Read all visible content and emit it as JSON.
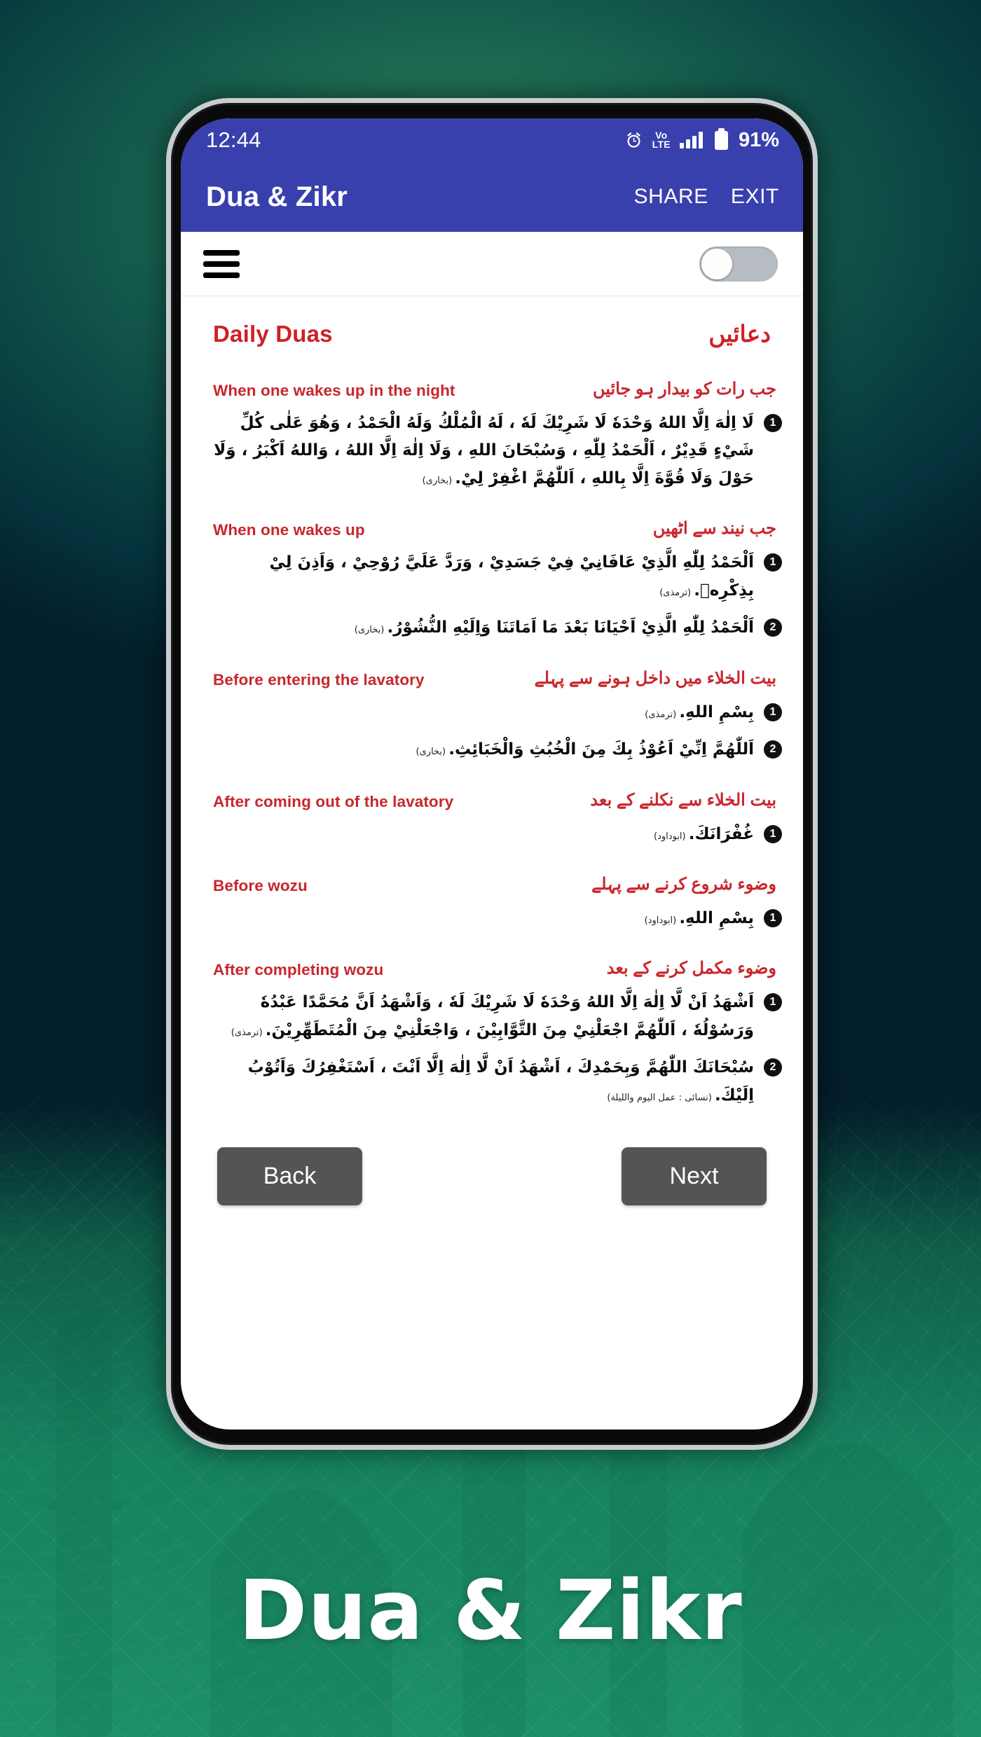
{
  "background": {
    "gradient_top": "#0d4a46",
    "gradient_bottom": "#1d8f67"
  },
  "phone": {
    "status_bar": {
      "time": "12:44",
      "alarm_icon": "alarm-clock-icon",
      "network_label_top": "Vo",
      "network_label_bottom": "LTE",
      "signal_icon": "signal-bars-icon",
      "battery_icon": "battery-icon",
      "battery_percent": "91%",
      "background_color": "#3840ad"
    },
    "app_bar": {
      "title": "Dua & Zikr",
      "share_label": "SHARE",
      "exit_label": "EXIT",
      "background_color": "#3840ad"
    },
    "toolbar": {
      "menu_icon": "hamburger-menu-icon",
      "toggle_state": "off"
    },
    "page_header": {
      "english": "Daily Duas",
      "urdu": "دعائیں",
      "color": "#cf2027"
    },
    "sections": [
      {
        "english": "When one wakes up in the night",
        "urdu": "جب رات کو بیدار ہو جائیں",
        "duas": [
          {
            "number": "1",
            "arabic": "لَا اِلٰهَ اِلَّا اللهُ وَحْدَهٗ لَا شَرِيْكَ لَهٗ ، لَهُ الْمُلْكُ وَلَهُ الْحَمْدُ ، وَهُوَ عَلٰى كُلِّ شَيْءٍ قَدِيْرٌ ، اَلْحَمْدُ لِلّٰهِ ، وَسُبْحَانَ اللهِ ، وَلَا اِلٰهَ اِلَّا اللهُ ، وَاللهُ اَكْبَرُ ، وَلَا حَوْلَ وَلَا قُوَّةَ اِلَّا بِاللهِ ، اَللّٰهُمَّ اغْفِرْ لِيْ.",
            "reference": "(بخاری)"
          }
        ]
      },
      {
        "english": "When one wakes up",
        "urdu": "جب نیند سے اٹھیں",
        "duas": [
          {
            "number": "1",
            "arabic": "اَلْحَمْدُ لِلّٰهِ الَّذِيْ عَافَانِيْ فِيْ جَسَدِيْ ، وَرَدَّ عَلَيَّ رُوْحِيْ ، وَاَذِنَ لِيْ بِذِكْرِهٖ.",
            "reference": "(ترمذی)"
          },
          {
            "number": "2",
            "arabic": "اَلْحَمْدُ لِلّٰهِ الَّذِيْ اَحْيَانَا بَعْدَ مَا اَمَاتَنَا وَاِلَيْهِ النُّشُوْرُ.",
            "reference": "(بخاری)"
          }
        ]
      },
      {
        "english": "Before entering the lavatory",
        "urdu": "بیت الخلاء میں داخل ہونے سے پہلے",
        "duas": [
          {
            "number": "1",
            "arabic": "بِسْمِ اللهِ.",
            "reference": "(ترمذی)"
          },
          {
            "number": "2",
            "arabic": "اَللّٰهُمَّ اِنِّيْ اَعُوْذُ بِكَ مِنَ الْخُبُثِ وَالْخَبَائِثِ.",
            "reference": "(بخاری)"
          }
        ]
      },
      {
        "english": "After coming out of the lavatory",
        "urdu": "بیت الخلاء سے نکلنے کے بعد",
        "duas": [
          {
            "number": "1",
            "arabic": "غُفْرَانَكَ.",
            "reference": "(ابوداود)"
          }
        ]
      },
      {
        "english": "Before wozu",
        "urdu": "وضوء شروع کرنے سے پہلے",
        "duas": [
          {
            "number": "1",
            "arabic": "بِسْمِ اللهِ.",
            "reference": "(ابوداود)"
          }
        ]
      },
      {
        "english": "After completing wozu",
        "urdu": "وضوء مکمل کرنے کے بعد",
        "duas": [
          {
            "number": "1",
            "arabic": "اَشْهَدُ اَنْ لَّا اِلٰهَ اِلَّا اللهُ وَحْدَهٗ لَا شَرِيْكَ لَهٗ ، وَاَشْهَدُ اَنَّ مُحَمَّدًا عَبْدُهٗ وَرَسُوْلُهٗ ، اَللّٰهُمَّ اجْعَلْنِيْ مِنَ التَّوَّابِيْنَ ، وَاجْعَلْنِيْ مِنَ الْمُتَطَهِّرِيْنَ.",
            "reference": "(ترمذی)"
          },
          {
            "number": "2",
            "arabic": "سُبْحَانَكَ اللّٰهُمَّ وَبِحَمْدِكَ ، اَشْهَدُ اَنْ لَّا اِلٰهَ اِلَّا اَنْتَ ، اَسْتَغْفِرُكَ وَاَتُوْبُ اِلَيْكَ.",
            "reference": "(نسائی : عمل اليوم والليلة)"
          }
        ]
      }
    ],
    "nav": {
      "back_label": "Back",
      "next_label": "Next"
    }
  },
  "brand": {
    "title": "Dua & Zikr"
  }
}
